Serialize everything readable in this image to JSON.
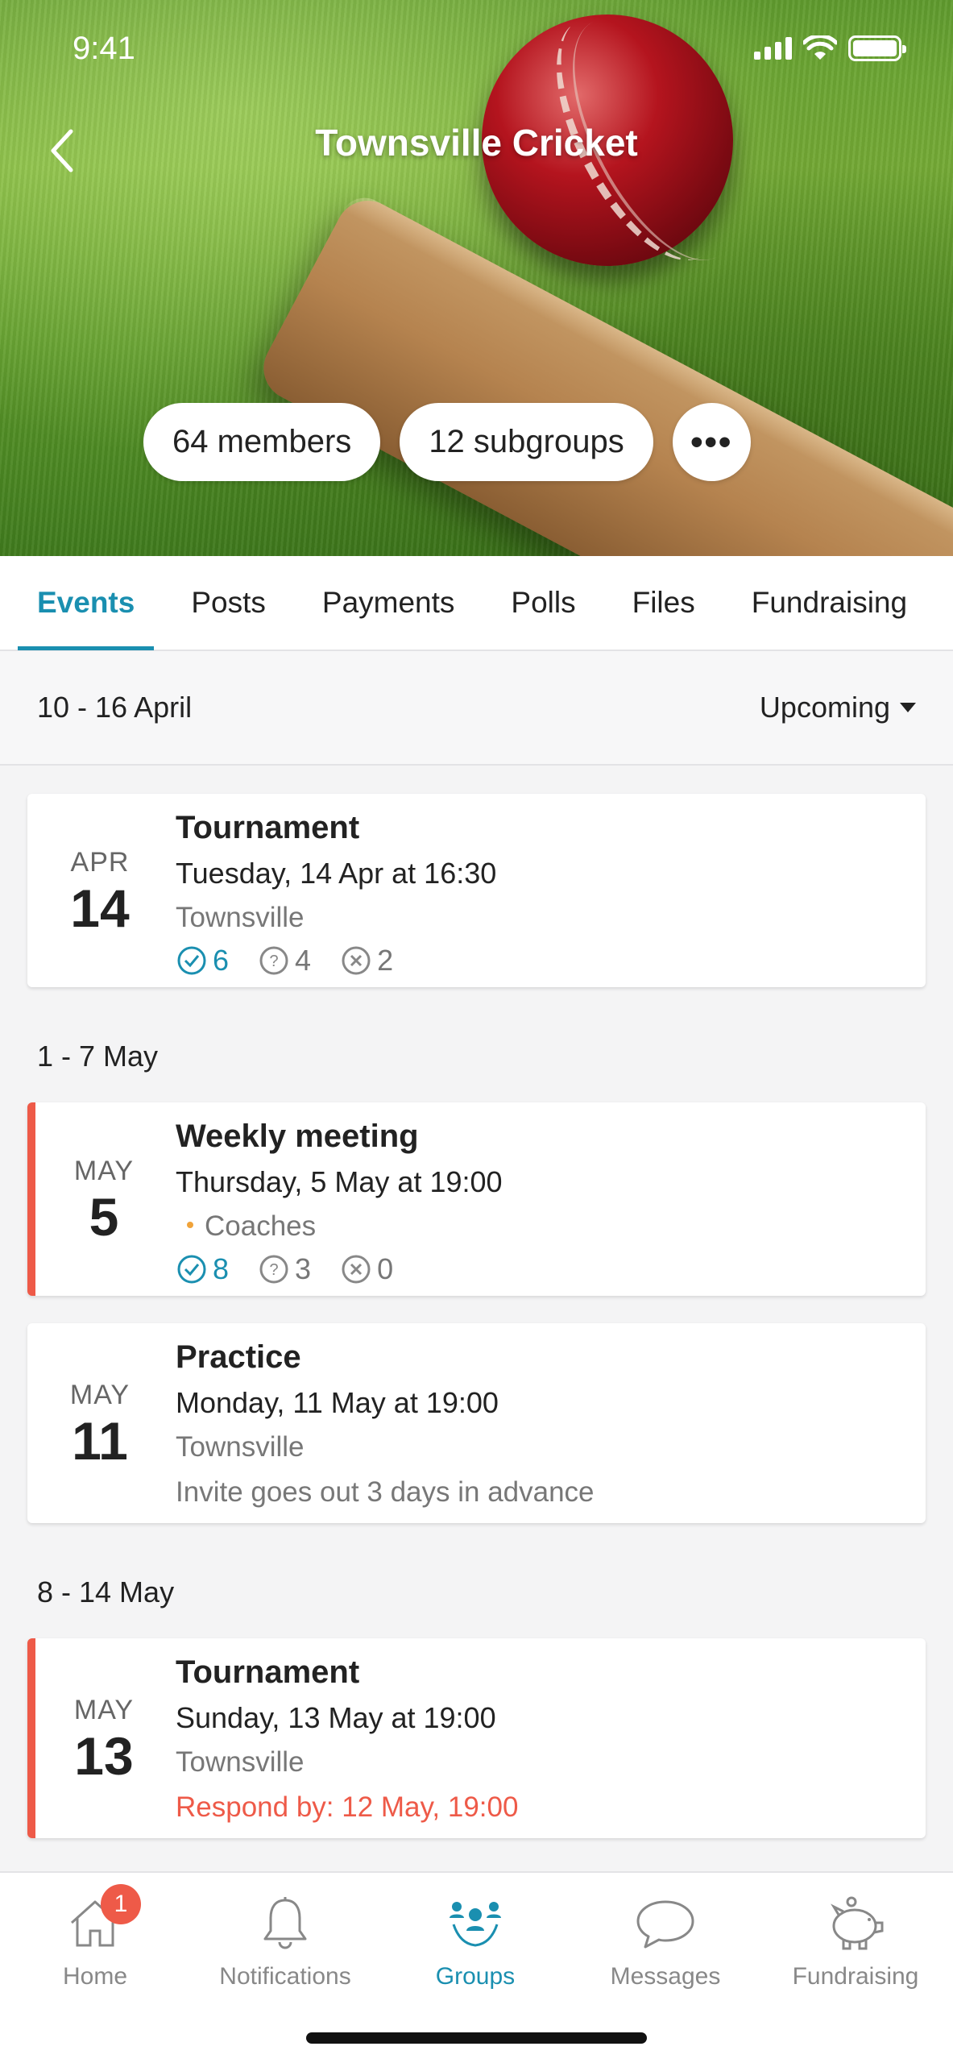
{
  "status_bar": {
    "time": "9:41"
  },
  "header": {
    "title": "Townsville Cricket",
    "members_label": "64 members",
    "subgroups_label": "12 subgroups",
    "more_label": "•••"
  },
  "tabs": [
    {
      "label": "Events",
      "active": true
    },
    {
      "label": "Posts",
      "active": false
    },
    {
      "label": "Payments",
      "active": false
    },
    {
      "label": "Polls",
      "active": false
    },
    {
      "label": "Files",
      "active": false
    },
    {
      "label": "Fundraising",
      "active": false
    }
  ],
  "range": {
    "label": "10 - 16 April",
    "filter": "Upcoming"
  },
  "groups": [
    {
      "label": "1 - 7 May"
    },
    {
      "label": "8 - 14 May"
    }
  ],
  "events": [
    {
      "month": "APR",
      "day": "14",
      "title": "Tournament",
      "when": "Tuesday, 14 Apr at 16:30",
      "where": "Townsville",
      "yes": "6",
      "maybe": "4",
      "no": "2"
    },
    {
      "month": "MAY",
      "day": "5",
      "title": "Weekly meeting",
      "when": "Thursday, 5 May at 19:00",
      "where": "Coaches",
      "yes": "8",
      "maybe": "3",
      "no": "0"
    },
    {
      "month": "MAY",
      "day": "11",
      "title": "Practice",
      "when": "Monday, 11 May at 19:00",
      "where": "Townsville",
      "note": "Invite goes out 3 days in advance"
    },
    {
      "month": "MAY",
      "day": "13",
      "title": "Tournament",
      "when": "Sunday, 13 May at 19:00",
      "where": "Townsville",
      "deadline": "Respond by: 12 May, 19:00"
    }
  ],
  "nav": [
    {
      "label": "Home",
      "icon": "home-icon",
      "badge": "1"
    },
    {
      "label": "Notifications",
      "icon": "bell-icon"
    },
    {
      "label": "Groups",
      "icon": "groups-icon",
      "active": true
    },
    {
      "label": "Messages",
      "icon": "chat-bubble-icon"
    },
    {
      "label": "Fundraising",
      "icon": "piggy-bank-icon"
    }
  ],
  "colors": {
    "accent": "#1a8fb0",
    "alert": "#ee5a48",
    "dot": "#f0a33a"
  }
}
